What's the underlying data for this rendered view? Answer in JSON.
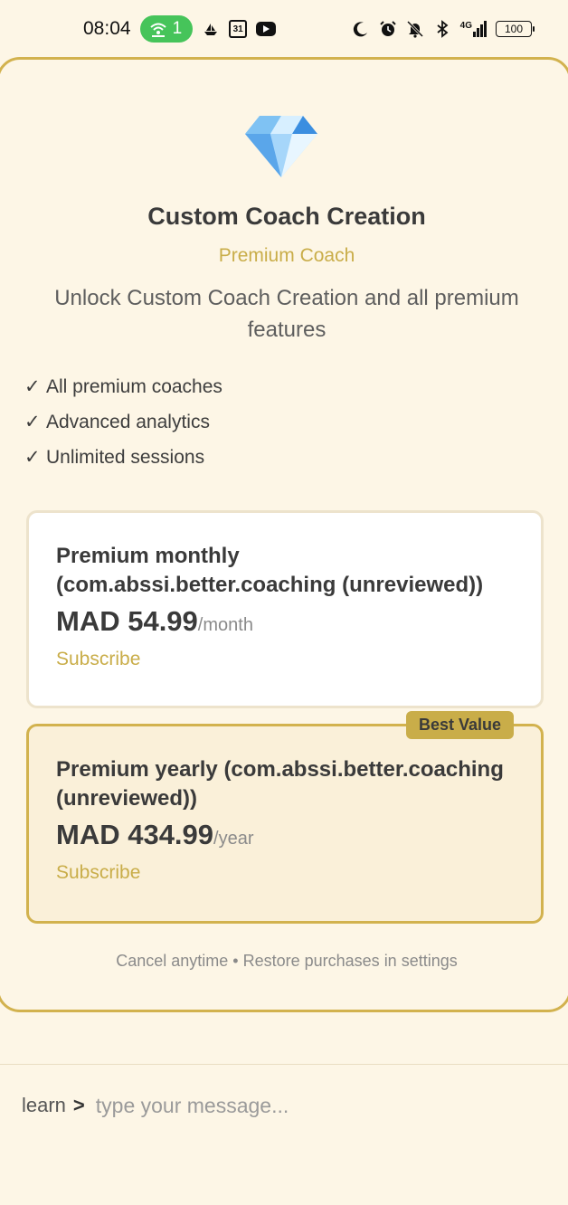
{
  "status_bar": {
    "time": "08:04",
    "hotspot_count": "1",
    "calendar_day": "31",
    "battery": "100",
    "network": "4G"
  },
  "paywall": {
    "icon": "diamond-icon",
    "title": "Custom Coach Creation",
    "subtitle": "Premium Coach",
    "description": "Unlock Custom Coach Creation and all premium features",
    "check_mark": "✓",
    "features": [
      "All premium coaches",
      "Advanced analytics",
      "Unlimited sessions"
    ],
    "plans": [
      {
        "name": "Premium monthly (com.abssi.better.coaching (unreviewed))",
        "price": "MAD 54.99",
        "period": "/month",
        "cta": "Subscribe"
      },
      {
        "name": "Premium yearly (com.abssi.better.coaching (unreviewed))",
        "price": "MAD 434.99",
        "period": "/year",
        "cta": "Subscribe",
        "badge": "Best Value"
      }
    ],
    "footnote": "Cancel anytime • Restore purchases in settings"
  },
  "chat_input": {
    "prompt": "learn",
    "prompt_arrow": ">",
    "placeholder": "type your message..."
  },
  "colors": {
    "background": "#fdf6e6",
    "accent_gold": "#c9ad49",
    "border_gold": "#d2b24e",
    "hotspot_green": "#46c45a"
  }
}
